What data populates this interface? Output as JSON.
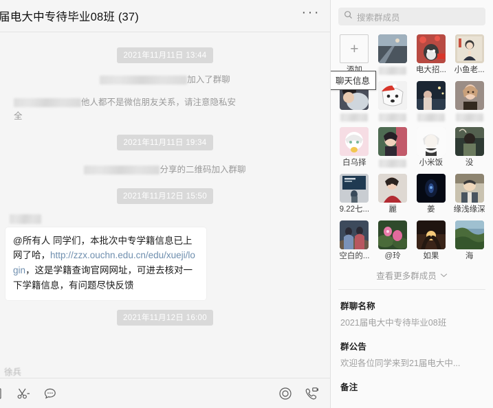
{
  "chat": {
    "title": "届电大中专待毕业08班 (37)",
    "more_icon": "···",
    "messages": [
      {
        "kind": "timestamp",
        "text": "2021年11月11日 13:44"
      },
      {
        "kind": "system",
        "prefix_redacted": true,
        "text": "加入了群聊"
      },
      {
        "kind": "system_wide",
        "prefix_redacted": true,
        "text": "他人都不是微信朋友关系，请注意隐私安全"
      },
      {
        "kind": "timestamp",
        "text": "2021年11月11日 19:34"
      },
      {
        "kind": "system",
        "prefix_redacted": true,
        "text": "分享的二维码加入群聊"
      },
      {
        "kind": "timestamp",
        "text": "2021年11月12日 15:50"
      }
    ],
    "bubble": {
      "part1": "@所有人 同学们，本批次中专学籍信息已上网了哈，",
      "link": "http://zzx.ouchn.edu.cn/edu/xueji/login",
      "part2": "，这是学籍查询官网网址，可进去核对一下学籍信息，有问题尽快反馈",
      "link_color": "#6e8eae"
    },
    "last_timestamp": "2021年11月12日 16:00",
    "bottom_sender": "徐兵"
  },
  "toolbar": {
    "left_icons": [
      "file-icon",
      "scissors-icon",
      "chat-bubble-icon"
    ],
    "right_icons": [
      "screen-record-icon",
      "video-call-icon"
    ]
  },
  "sidebar": {
    "search": {
      "placeholder": "搜索群成员",
      "icon": "search-icon"
    },
    "tooltip": "聊天信息",
    "add_label": "添加",
    "add_symbol": "+",
    "members": [
      {
        "name": "添加",
        "type": "add"
      },
      {
        "name": "",
        "redacted": true,
        "avatar": "road-sunset"
      },
      {
        "name": "电大招...",
        "avatar": "dog-flag"
      },
      {
        "name": "小鱼老...",
        "avatar": "cartoon-boy"
      },
      {
        "name": "",
        "redacted": true,
        "avatar": "person-dark"
      },
      {
        "name": "",
        "redacted": true,
        "avatar": "husky-santa"
      },
      {
        "name": "",
        "redacted": true,
        "avatar": "night-bridge"
      },
      {
        "name": "",
        "redacted": true,
        "avatar": "woman-portrait"
      },
      {
        "name": "白乌择",
        "avatar": "anime-white"
      },
      {
        "name": "",
        "redacted": true,
        "avatar": "girl-hat"
      },
      {
        "name": "小米饭",
        "avatar": "anime-sketch"
      },
      {
        "name": "没",
        "avatar": "person-green"
      },
      {
        "name": "9.22七...",
        "avatar": "blue-poster"
      },
      {
        "name": "麗",
        "avatar": "red-dress"
      },
      {
        "name": "姜",
        "avatar": "dark-blue"
      },
      {
        "name": "缘浅缘深",
        "avatar": "cartoon-man"
      },
      {
        "name": "空白的...",
        "avatar": "two-figures"
      },
      {
        "name": "@玲",
        "avatar": "lotus"
      },
      {
        "name": "如果",
        "avatar": "sunset-hands"
      },
      {
        "name": "海",
        "avatar": "green-hills"
      }
    ],
    "more_members": "查看更多群成员",
    "chevron": "⌄",
    "info": [
      {
        "label": "群聊名称",
        "value": "2021届电大中专待毕业08班"
      },
      {
        "label": "群公告",
        "value": "欢迎各位同学来到21届电大中..."
      },
      {
        "label": "备注",
        "value": ""
      }
    ]
  }
}
